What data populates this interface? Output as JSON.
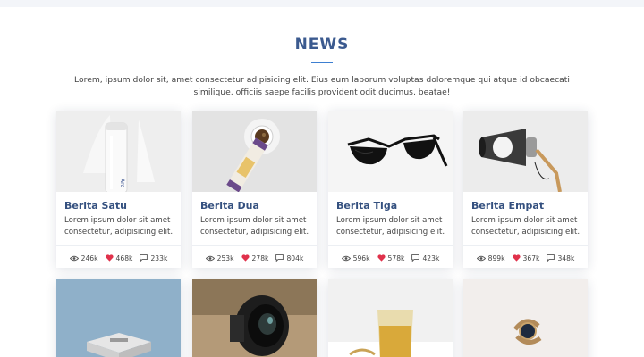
{
  "section": {
    "title": "NEWS",
    "intro": "Lorem, ipsum dolor sit, amet consectetur adipisicing elit. Eius eum laborum voluptas doloremque qui atque id obcaecati similique, officiis saepe facilis provident odit ducimus, beatae!"
  },
  "colors": {
    "accent": "#3d7fd1",
    "title": "#3b5a8f",
    "heart": "#e0314b"
  },
  "cards": [
    {
      "title": "Berita Satu",
      "desc": "Lorem ipsum dolor sit amet consectetur, adipisicing elit.",
      "views": "246k",
      "likes": "468k",
      "comments": "233k",
      "photo": "white-bottle"
    },
    {
      "title": "Berita Dua",
      "desc": "Lorem ipsum dolor sit amet consectetur, adipisicing elit.",
      "views": "253k",
      "likes": "278k",
      "comments": "804k",
      "photo": "tea-and-can"
    },
    {
      "title": "Berita Tiga",
      "desc": "Lorem ipsum dolor sit amet consectetur, adipisicing elit.",
      "views": "596k",
      "likes": "578k",
      "comments": "423k",
      "photo": "sunglasses"
    },
    {
      "title": "Berita Empat",
      "desc": "Lorem ipsum dolor sit amet consectetur, adipisicing elit.",
      "views": "899k",
      "likes": "367k",
      "comments": "348k",
      "photo": "desk-lamp"
    }
  ],
  "cards_row2": [
    {
      "photo": "stool"
    },
    {
      "photo": "camera-lens"
    },
    {
      "photo": "whisky-glass"
    },
    {
      "photo": "wristwatch"
    }
  ],
  "icons": {
    "views": "eye-icon",
    "likes": "heart-icon",
    "comments": "comment-icon"
  }
}
